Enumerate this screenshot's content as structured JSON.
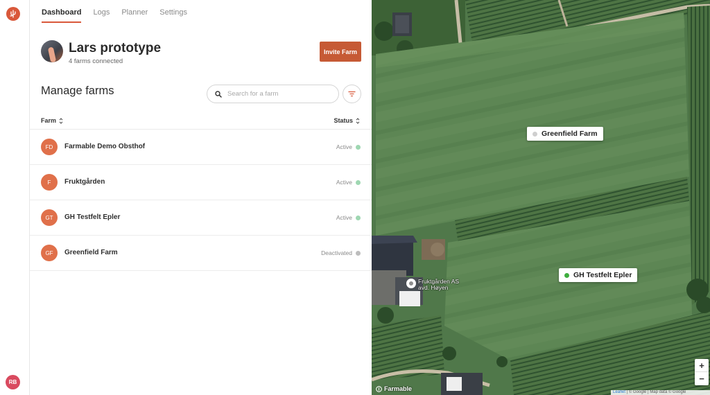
{
  "nav": {
    "tabs": [
      {
        "label": "Dashboard",
        "active": true
      },
      {
        "label": "Logs"
      },
      {
        "label": "Planner"
      },
      {
        "label": "Settings"
      }
    ],
    "user_initials": "RB"
  },
  "org": {
    "title": "Lars prototype",
    "subtitle": "4 farms connected",
    "invite_label": "Invite Farm"
  },
  "farms_section": {
    "title": "Manage farms",
    "search_placeholder": "Search for a farm",
    "columns": {
      "farm": "Farm",
      "status": "Status"
    },
    "rows": [
      {
        "initials": "FD",
        "name": "Farmable Demo Obsthof",
        "status": "Active"
      },
      {
        "initials": "F",
        "name": "Fruktgården",
        "status": "Active"
      },
      {
        "initials": "GT",
        "name": "GH Testfelt Epler",
        "status": "Active"
      },
      {
        "initials": "GF",
        "name": "Greenfield Farm",
        "status": "Deactivated"
      }
    ]
  },
  "map": {
    "labels": [
      {
        "name": "Greenfield Farm",
        "dot_color": "#cfcfcf"
      },
      {
        "name": "GH Testfelt Epler",
        "dot_color": "#3fae3f"
      }
    ],
    "poi_line1": "Fruktgården AS",
    "poi_line2": "avd. Høyen",
    "zoom_in": "+",
    "zoom_out": "−",
    "watermark": "Farmable",
    "attribution_leaflet": "Leaflet",
    "attribution_google": "© Google",
    "attribution_rest": "Map data © Google"
  },
  "colors": {
    "accent": "#d9583a",
    "active_dot": "#9fd7b2",
    "deactivated_dot": "#bdbdbd"
  },
  "icons": {
    "logo": "farmable-logo-icon",
    "search": "search-icon",
    "filter": "filter-icon",
    "sort": "sort-icon"
  }
}
